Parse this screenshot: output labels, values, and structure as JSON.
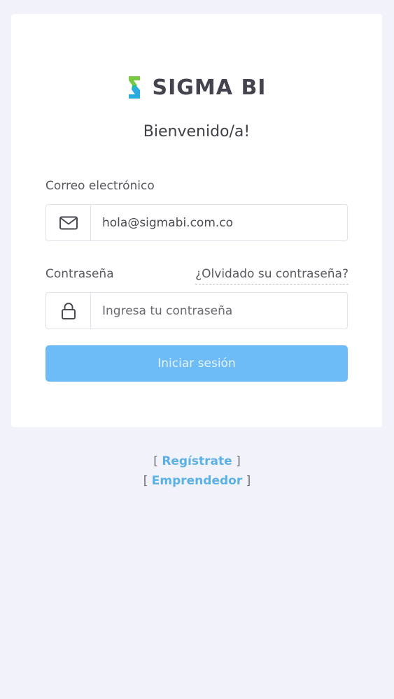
{
  "brand": {
    "name": "SIGMA BI",
    "colors": {
      "logo_top": "#7ac943",
      "logo_bottom": "#29abe2"
    }
  },
  "welcome": "Bienvenido/a!",
  "email": {
    "label": "Correo electrónico",
    "value": "hola@sigmabi.com.co",
    "icon": "envelope-icon"
  },
  "password": {
    "label": "Contraseña",
    "forgot_link": "¿Olvidado su contraseña?",
    "placeholder": "Ingresa tu contraseña",
    "icon": "lock-icon"
  },
  "submit": {
    "label": "Iniciar sesión",
    "color": "#6ebcf7"
  },
  "links": {
    "register": "Regístrate",
    "entrepreneur": "Emprendedor",
    "open_bracket": "[",
    "close_bracket": "]",
    "color": "#5ab1e6"
  },
  "colors": {
    "background": "#f2f2fa",
    "card": "#ffffff"
  }
}
